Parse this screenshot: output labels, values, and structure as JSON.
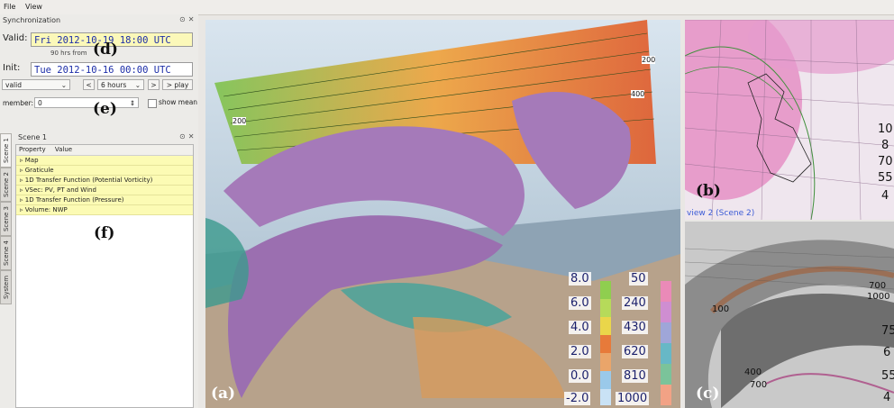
{
  "menu": {
    "file": "File",
    "view": "View"
  },
  "sync": {
    "title": "Synchronization",
    "valid_label": "Valid:",
    "valid_value": "Fri 2012-10-19 18:00 UTC",
    "hrs_from": "90 hrs from",
    "init_label": "Init:",
    "init_value": "Tue 2012-10-16 00:00 UTC",
    "sync_mode": "valid",
    "step": "6 hours",
    "back_btn": "<",
    "fwd_btn": ">",
    "play_btn": "> play",
    "member_label": "member:",
    "member_value": "0",
    "show_mean": "show mean"
  },
  "scene": {
    "title": "Scene 1",
    "col_property": "Property",
    "col_value": "Value",
    "items": [
      "Map",
      "Graticule",
      "1D Transfer Function (Potential Vorticity)",
      "VSec: PV, PT and Wind",
      "1D Transfer Function (Pressure)",
      "Volume: NWP"
    ]
  },
  "tabs": [
    "Scene 1",
    "Scene 2",
    "Scene 3",
    "Scene 4",
    "System"
  ],
  "letters": {
    "d": "(d)",
    "e": "(e)",
    "f": "(f)",
    "a": "(a)",
    "b": "(b)",
    "c": "(c)"
  },
  "view_a": {
    "pv_ticks": [
      "8.0",
      "6.0",
      "4.0",
      "2.0",
      "0.0",
      "-2.0"
    ],
    "p_ticks": [
      "50",
      "240",
      "430",
      "620",
      "810",
      "1000"
    ],
    "section_labels": [
      "200",
      "400",
      "200"
    ]
  },
  "view_b": {
    "caption": "view 2 (Scene 2)",
    "edge_numbers": [
      "10",
      "8",
      "70",
      "55",
      "4"
    ]
  },
  "view_c": {
    "labels": [
      "100",
      "400",
      "700",
      "700",
      "1000"
    ],
    "edge_numbers": [
      "75",
      "6",
      "55",
      "4"
    ]
  },
  "colors": {
    "pv_scale": [
      "#c9e2f5",
      "#9ac9ea",
      "#e77a3a",
      "#eaa56a",
      "#ead64a",
      "#b6da5a",
      "#8fce4f"
    ],
    "p_scale": [
      "#f2a285",
      "#d9c070",
      "#7bc39a",
      "#67b8c6",
      "#9fa6d8",
      "#cf8ed1",
      "#ea8ab8"
    ],
    "sky": "#bfd6e8",
    "iso_purple": "#a57ab9"
  }
}
